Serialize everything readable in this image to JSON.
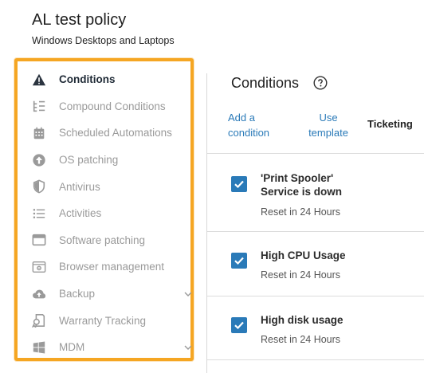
{
  "policy": {
    "title": "AL test policy",
    "subtitle": "Windows Desktops and Laptops"
  },
  "sidebar": {
    "highlight_color": "#f5a623",
    "items": [
      {
        "label": "Conditions",
        "icon": "warning-icon",
        "active": true
      },
      {
        "label": "Compound Conditions",
        "icon": "checklist-icon"
      },
      {
        "label": "Scheduled Automations",
        "icon": "calendar-icon"
      },
      {
        "label": "OS patching",
        "icon": "upload-circle-icon"
      },
      {
        "label": "Antivirus",
        "icon": "shield-icon"
      },
      {
        "label": "Activities",
        "icon": "list-icon"
      },
      {
        "label": "Software patching",
        "icon": "window-icon"
      },
      {
        "label": "Browser management",
        "icon": "browser-gear-icon"
      },
      {
        "label": "Backup",
        "icon": "cloud-upload-icon",
        "expandable": true
      },
      {
        "label": "Warranty Tracking",
        "icon": "warranty-icon"
      },
      {
        "label": "MDM",
        "icon": "windows-logo-icon",
        "expandable": true
      }
    ]
  },
  "main": {
    "title": "Conditions",
    "toolbar": {
      "add_line1": "Add a",
      "add_line2": "condition",
      "use_line1": "Use",
      "use_line2": "template",
      "ticketing": "Ticketing"
    },
    "conditions": [
      {
        "name_line1": "'Print Spooler'",
        "name_line2": "Service is down",
        "reset": "Reset in 24 Hours",
        "checked": true
      },
      {
        "name_line1": "High CPU Usage",
        "name_line2": "",
        "reset": "Reset in 24 Hours",
        "checked": true
      },
      {
        "name_line1": "High disk usage",
        "name_line2": "",
        "reset": "Reset in 24 Hours",
        "checked": true
      }
    ],
    "accent_color": "#2a7ab8"
  }
}
